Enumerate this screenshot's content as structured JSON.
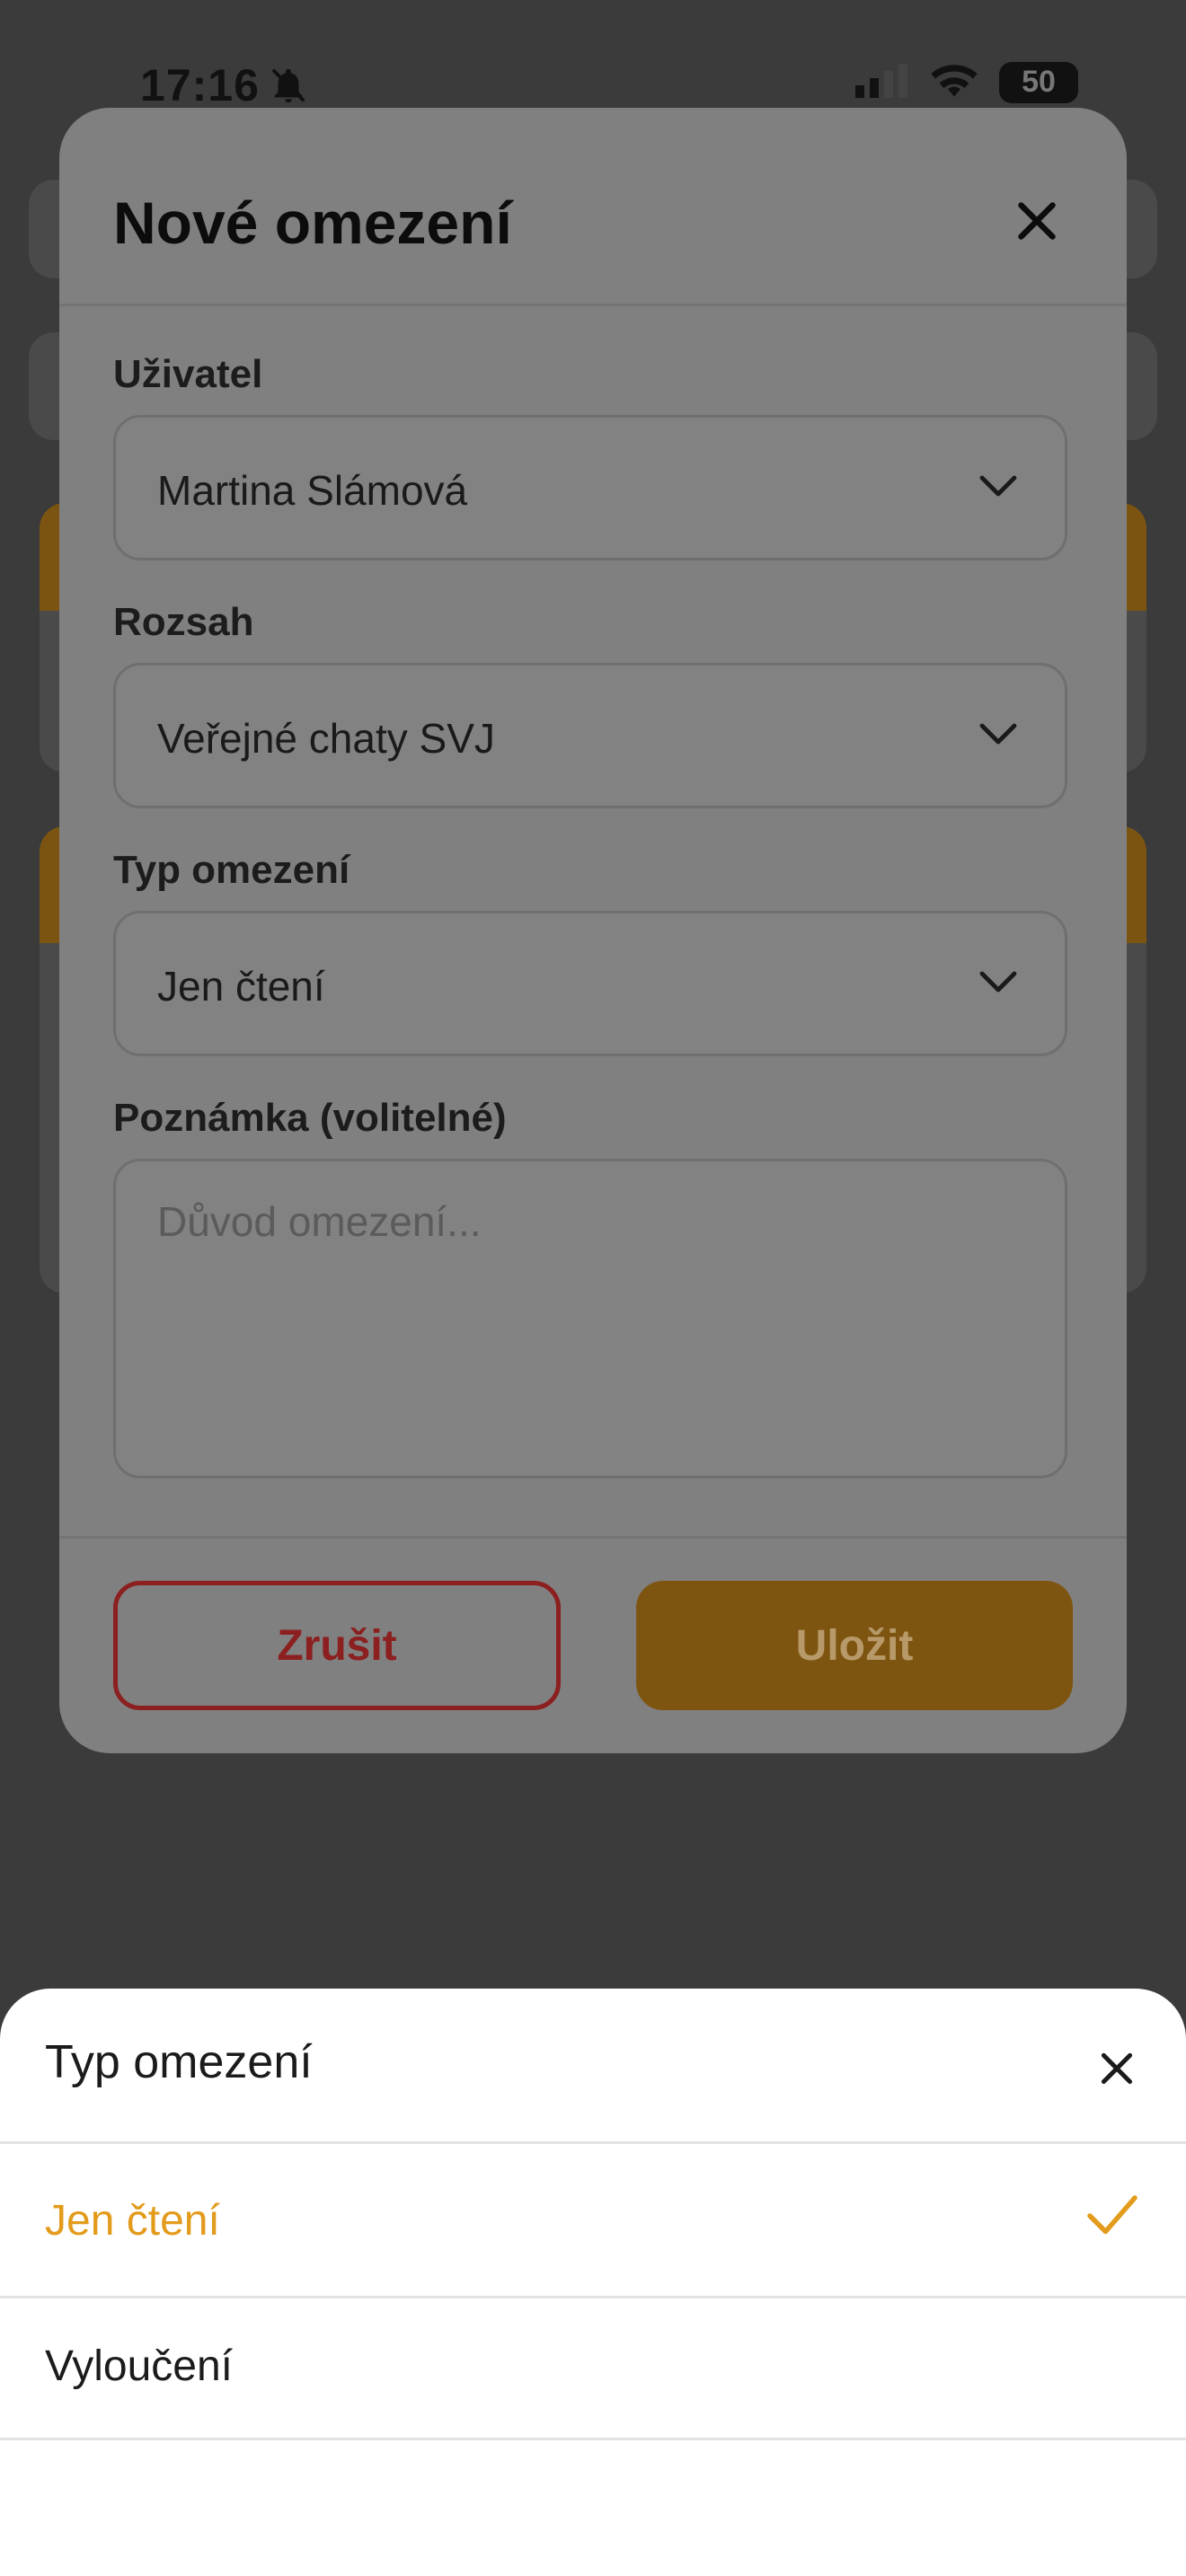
{
  "status_bar": {
    "time": "17:16",
    "battery": "50"
  },
  "modal": {
    "title": "Nové omezení",
    "fields": {
      "user": {
        "label": "Uživatel",
        "value": "Martina Slámová"
      },
      "scope": {
        "label": "Rozsah",
        "value": "Veřejné chaty SVJ"
      },
      "type": {
        "label": "Typ omezení",
        "value": "Jen čtení"
      },
      "note": {
        "label": "Poznámka (volitelné)",
        "placeholder": "Důvod omezení..."
      }
    },
    "cancel_label": "Zrušit",
    "save_label": "Uložit"
  },
  "sheet": {
    "title": "Typ omezení",
    "options": [
      {
        "label": "Jen čtení",
        "selected": true
      },
      {
        "label": "Vyloučení",
        "selected": false
      }
    ]
  },
  "colors": {
    "accent": "#E39B1C",
    "danger": "#B02A2A"
  },
  "icons": [
    "bell-off-icon",
    "signal-icon",
    "wifi-icon",
    "battery-icon",
    "close-icon",
    "chevron-down-icon",
    "checkmark-icon"
  ]
}
